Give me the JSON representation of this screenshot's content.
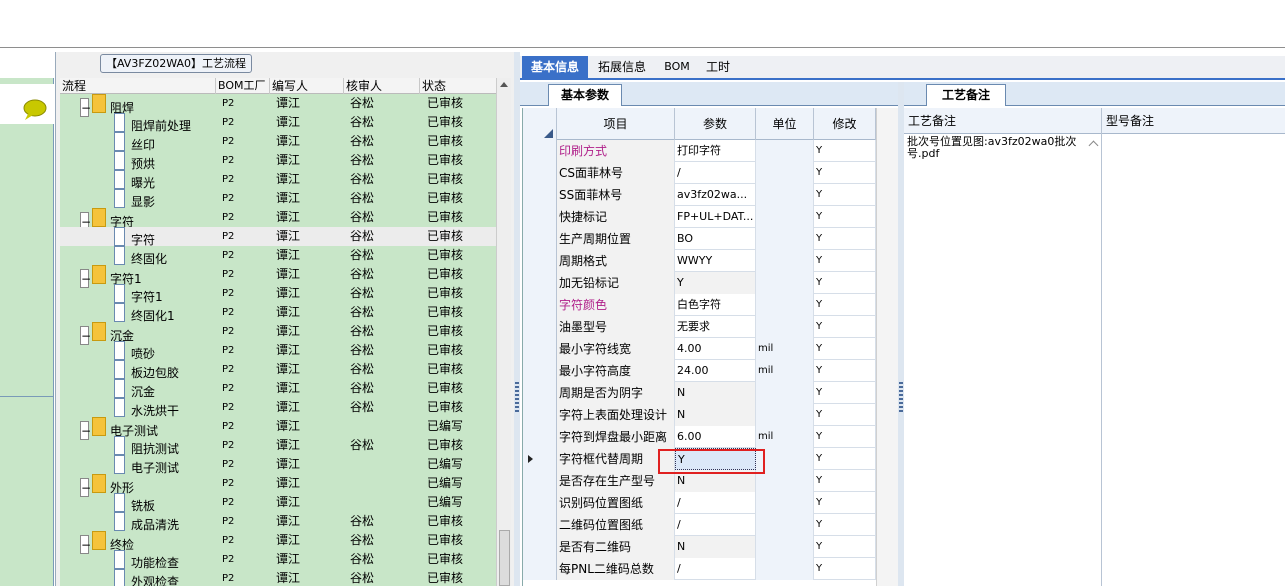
{
  "flow_panel": {
    "title": "【AV3FZ02WA0】工艺流程",
    "columns": [
      "流程",
      "BOM工厂",
      "编写人",
      "核审人",
      "状态"
    ]
  },
  "tree_rows": [
    {
      "name": "阻焊",
      "group": true,
      "bom": "P2",
      "writer": "谭江",
      "reviewer": "谷松",
      "status": "已审核"
    },
    {
      "name": "阻焊前处理",
      "group": false,
      "bom": "P2",
      "writer": "谭江",
      "reviewer": "谷松",
      "status": "已审核"
    },
    {
      "name": "丝印",
      "group": false,
      "bom": "P2",
      "writer": "谭江",
      "reviewer": "谷松",
      "status": "已审核"
    },
    {
      "name": "预烘",
      "group": false,
      "bom": "P2",
      "writer": "谭江",
      "reviewer": "谷松",
      "status": "已审核"
    },
    {
      "name": "曝光",
      "group": false,
      "bom": "P2",
      "writer": "谭江",
      "reviewer": "谷松",
      "status": "已审核"
    },
    {
      "name": "显影",
      "group": false,
      "bom": "P2",
      "writer": "谭江",
      "reviewer": "谷松",
      "status": "已审核"
    },
    {
      "name": "字符",
      "group": true,
      "bom": "P2",
      "writer": "谭江",
      "reviewer": "谷松",
      "status": "已审核"
    },
    {
      "name": "字符",
      "group": false,
      "bom": "P2",
      "writer": "谭江",
      "reviewer": "谷松",
      "status": "已审核",
      "selected": true
    },
    {
      "name": "终固化",
      "group": false,
      "bom": "P2",
      "writer": "谭江",
      "reviewer": "谷松",
      "status": "已审核"
    },
    {
      "name": "字符1",
      "group": true,
      "bom": "P2",
      "writer": "谭江",
      "reviewer": "谷松",
      "status": "已审核"
    },
    {
      "name": "字符1",
      "group": false,
      "bom": "P2",
      "writer": "谭江",
      "reviewer": "谷松",
      "status": "已审核"
    },
    {
      "name": "终固化1",
      "group": false,
      "bom": "P2",
      "writer": "谭江",
      "reviewer": "谷松",
      "status": "已审核"
    },
    {
      "name": "沉金",
      "group": true,
      "bom": "P2",
      "writer": "谭江",
      "reviewer": "谷松",
      "status": "已审核"
    },
    {
      "name": "喷砂",
      "group": false,
      "bom": "P2",
      "writer": "谭江",
      "reviewer": "谷松",
      "status": "已审核"
    },
    {
      "name": "板边包胶",
      "group": false,
      "bom": "P2",
      "writer": "谭江",
      "reviewer": "谷松",
      "status": "已审核"
    },
    {
      "name": "沉金",
      "group": false,
      "bom": "P2",
      "writer": "谭江",
      "reviewer": "谷松",
      "status": "已审核"
    },
    {
      "name": "水洗烘干",
      "group": false,
      "bom": "P2",
      "writer": "谭江",
      "reviewer": "谷松",
      "status": "已审核"
    },
    {
      "name": "电子测试",
      "group": true,
      "bom": "P2",
      "writer": "谭江",
      "reviewer": "",
      "status": "已编写"
    },
    {
      "name": "阻抗测试",
      "group": false,
      "bom": "P2",
      "writer": "谭江",
      "reviewer": "谷松",
      "status": "已审核"
    },
    {
      "name": "电子测试",
      "group": false,
      "bom": "P2",
      "writer": "谭江",
      "reviewer": "",
      "status": "已编写"
    },
    {
      "name": "外形",
      "group": true,
      "bom": "P2",
      "writer": "谭江",
      "reviewer": "",
      "status": "已编写"
    },
    {
      "name": "铣板",
      "group": false,
      "bom": "P2",
      "writer": "谭江",
      "reviewer": "",
      "status": "已编写"
    },
    {
      "name": "成品清洗",
      "group": false,
      "bom": "P2",
      "writer": "谭江",
      "reviewer": "谷松",
      "status": "已审核"
    },
    {
      "name": "终检",
      "group": true,
      "bom": "P2",
      "writer": "谭江",
      "reviewer": "谷松",
      "status": "已审核"
    },
    {
      "name": "功能检查",
      "group": false,
      "bom": "P2",
      "writer": "谭江",
      "reviewer": "谷松",
      "status": "已审核"
    },
    {
      "name": "外观检查",
      "group": false,
      "bom": "P2",
      "writer": "谭江",
      "reviewer": "谷松",
      "status": "已审核"
    }
  ],
  "tabs": [
    "基本信息",
    "拓展信息",
    "BOM",
    "工时"
  ],
  "basic_params": {
    "tab_label": "基本参数",
    "columns": [
      "项目",
      "参数",
      "单位",
      "修改"
    ],
    "rows": [
      {
        "item": "印刷方式",
        "value": "打印字符",
        "unit": "",
        "mod": "Y",
        "pink": true
      },
      {
        "item": "CS面菲林号",
        "value": "/",
        "unit": "",
        "mod": "Y"
      },
      {
        "item": "SS面菲林号",
        "value": "av3fz02wa...",
        "unit": "",
        "mod": "Y"
      },
      {
        "item": "快捷标记",
        "value": "FP+UL+DAT...",
        "unit": "",
        "mod": "Y"
      },
      {
        "item": "生产周期位置",
        "value": "BO",
        "unit": "",
        "mod": "Y"
      },
      {
        "item": "周期格式",
        "value": "WWYY",
        "unit": "",
        "mod": "Y"
      },
      {
        "item": "加无铅标记",
        "value": "Y",
        "unit": "",
        "mod": "Y"
      },
      {
        "item": "字符颜色",
        "value": "白色字符",
        "unit": "",
        "mod": "Y",
        "pink": true
      },
      {
        "item": "油墨型号",
        "value": "无要求",
        "unit": "",
        "mod": "Y"
      },
      {
        "item": "最小字符线宽",
        "value": "4.00",
        "unit": "mil",
        "mod": "Y"
      },
      {
        "item": "最小字符高度",
        "value": "24.00",
        "unit": "mil",
        "mod": "Y"
      },
      {
        "item": "周期是否为阴字",
        "value": "N",
        "unit": "",
        "mod": "Y"
      },
      {
        "item": "字符上表面处理设计",
        "value": "N",
        "unit": "",
        "mod": "Y"
      },
      {
        "item": "字符到焊盘最小距离",
        "value": "6.00",
        "unit": "mil",
        "mod": "Y"
      },
      {
        "item": "字符框代替周期",
        "value": "Y",
        "unit": "",
        "mod": "Y",
        "editing": true
      },
      {
        "item": "是否存在生产型号",
        "value": "N",
        "unit": "",
        "mod": "Y"
      },
      {
        "item": "识别码位置图纸",
        "value": "/",
        "unit": "",
        "mod": "Y"
      },
      {
        "item": "二维码位置图纸",
        "value": "/",
        "unit": "",
        "mod": "Y"
      },
      {
        "item": "是否有二维码",
        "value": "N",
        "unit": "",
        "mod": "Y"
      },
      {
        "item": "每PNL二维码总数",
        "value": "/",
        "unit": "",
        "mod": "Y"
      }
    ]
  },
  "notes": {
    "tab_label": "工艺备注",
    "col1": "工艺备注",
    "col2": "型号备注",
    "text": "批次号位置见图:av3fz02wa0批次号.pdf"
  },
  "colors": {
    "accent": "#3a70c8",
    "tree_bg": "#c8e6c8",
    "highlight": "#e02020",
    "pink": "#b0208a"
  }
}
